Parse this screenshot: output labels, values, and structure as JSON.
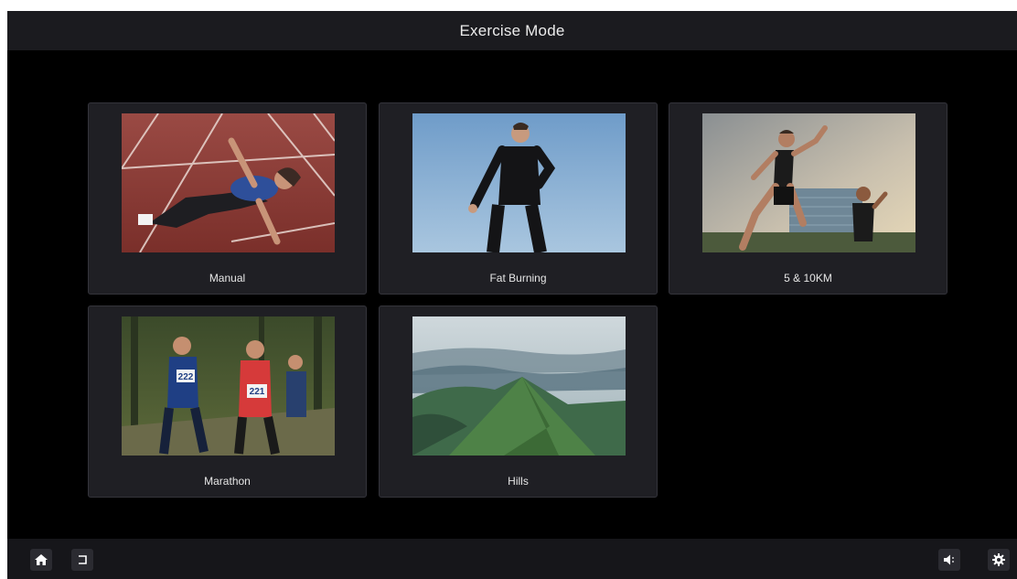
{
  "header": {
    "title": "Exercise Mode"
  },
  "modes": [
    {
      "label": "Manual",
      "image": "track-stretching-photo"
    },
    {
      "label": "Fat Burning",
      "image": "runner-sky-photo"
    },
    {
      "label": "5 & 10KM",
      "image": "city-runners-photo"
    },
    {
      "label": "Marathon",
      "image": "marathon-runners-photo",
      "bibs": [
        "222",
        "221"
      ]
    },
    {
      "label": "Hills",
      "image": "misty-mountains-photo"
    }
  ],
  "footer": {
    "left_icons": [
      "home-icon",
      "back-icon"
    ],
    "right_icons": [
      "volume-icon",
      "gear-icon"
    ]
  },
  "colors": {
    "background": "#000000",
    "bar": "#1b1b1f",
    "card": "#1f1f24",
    "text": "#e6e6e6"
  }
}
